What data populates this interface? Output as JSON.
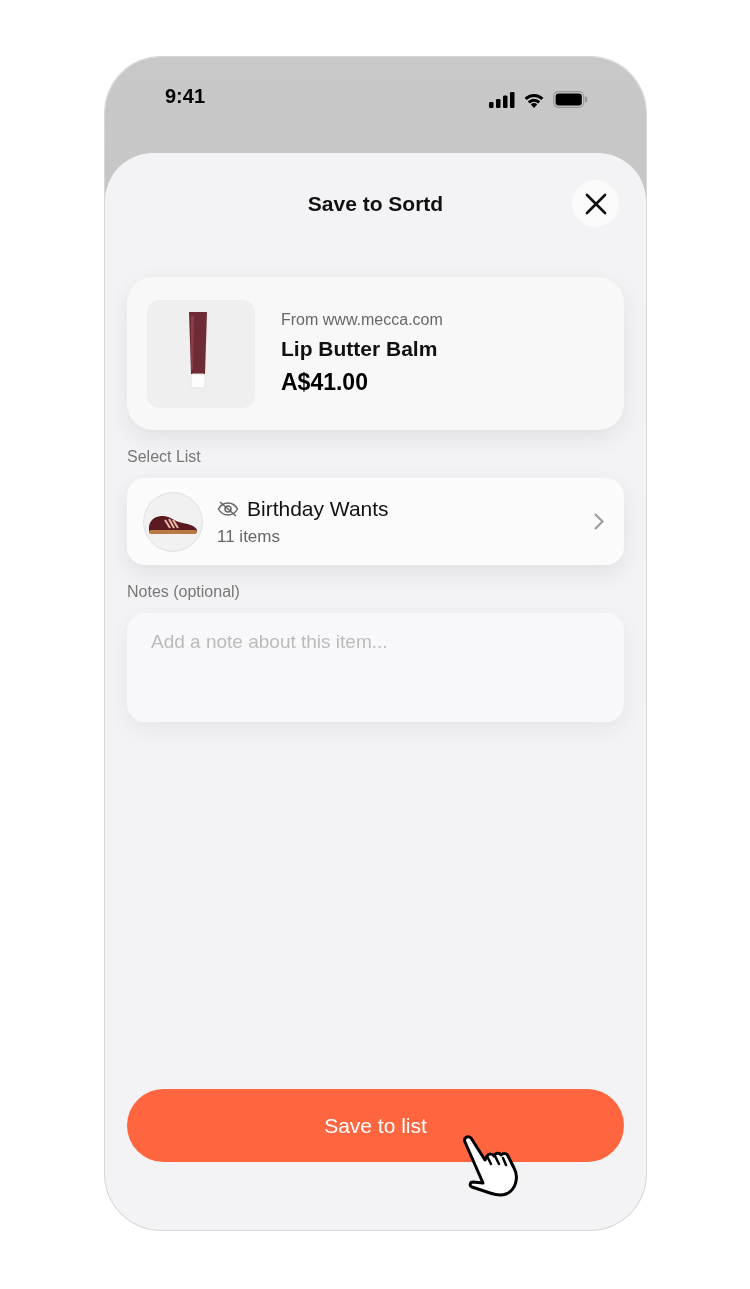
{
  "status_bar": {
    "time": "9:41"
  },
  "sheet": {
    "title": "Save to Sortd"
  },
  "product": {
    "source": "From www.mecca.com",
    "name": "Lip Butter Balm",
    "price": "A$41.00"
  },
  "select_list": {
    "label": "Select List",
    "list": {
      "name": "Birthday Wants",
      "count": "11 items",
      "hidden": true
    }
  },
  "notes": {
    "label": "Notes (optional)",
    "placeholder": "Add a note about this item..."
  },
  "save_button": {
    "label": "Save to list"
  }
}
